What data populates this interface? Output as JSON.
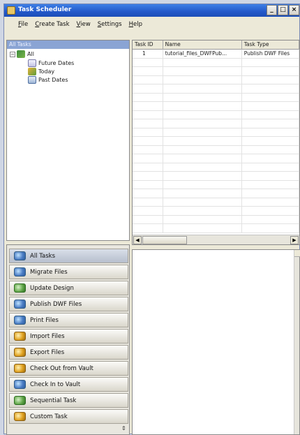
{
  "window": {
    "title": "Task Scheduler",
    "controls": [
      "_",
      "□",
      "×"
    ]
  },
  "menu": [
    "File",
    "Create Task",
    "View",
    "Settings",
    "Help"
  ],
  "tree": {
    "header": "All Tasks",
    "root": {
      "label": "All",
      "expander": "−"
    },
    "children": [
      "Future Dates",
      "Today",
      "Past Dates"
    ]
  },
  "grid": {
    "columns": [
      "Task ID",
      "Name",
      "Task Type"
    ],
    "rows": [
      [
        "1",
        "tutorial_files_DWFPub...",
        "Publish DWF Files"
      ]
    ],
    "scroll": {
      "left_arrow": "◀",
      "right_arrow": "▶"
    }
  },
  "nav": {
    "buttons": [
      "All Tasks",
      "Migrate Files",
      "Update Design",
      "Publish DWF Files",
      "Print Files",
      "Import Files",
      "Export Files",
      "Check Out from Vault",
      "Check In to Vault",
      "Sequential Task",
      "Custom Task"
    ],
    "active": "All Tasks",
    "grip": "⇕"
  }
}
